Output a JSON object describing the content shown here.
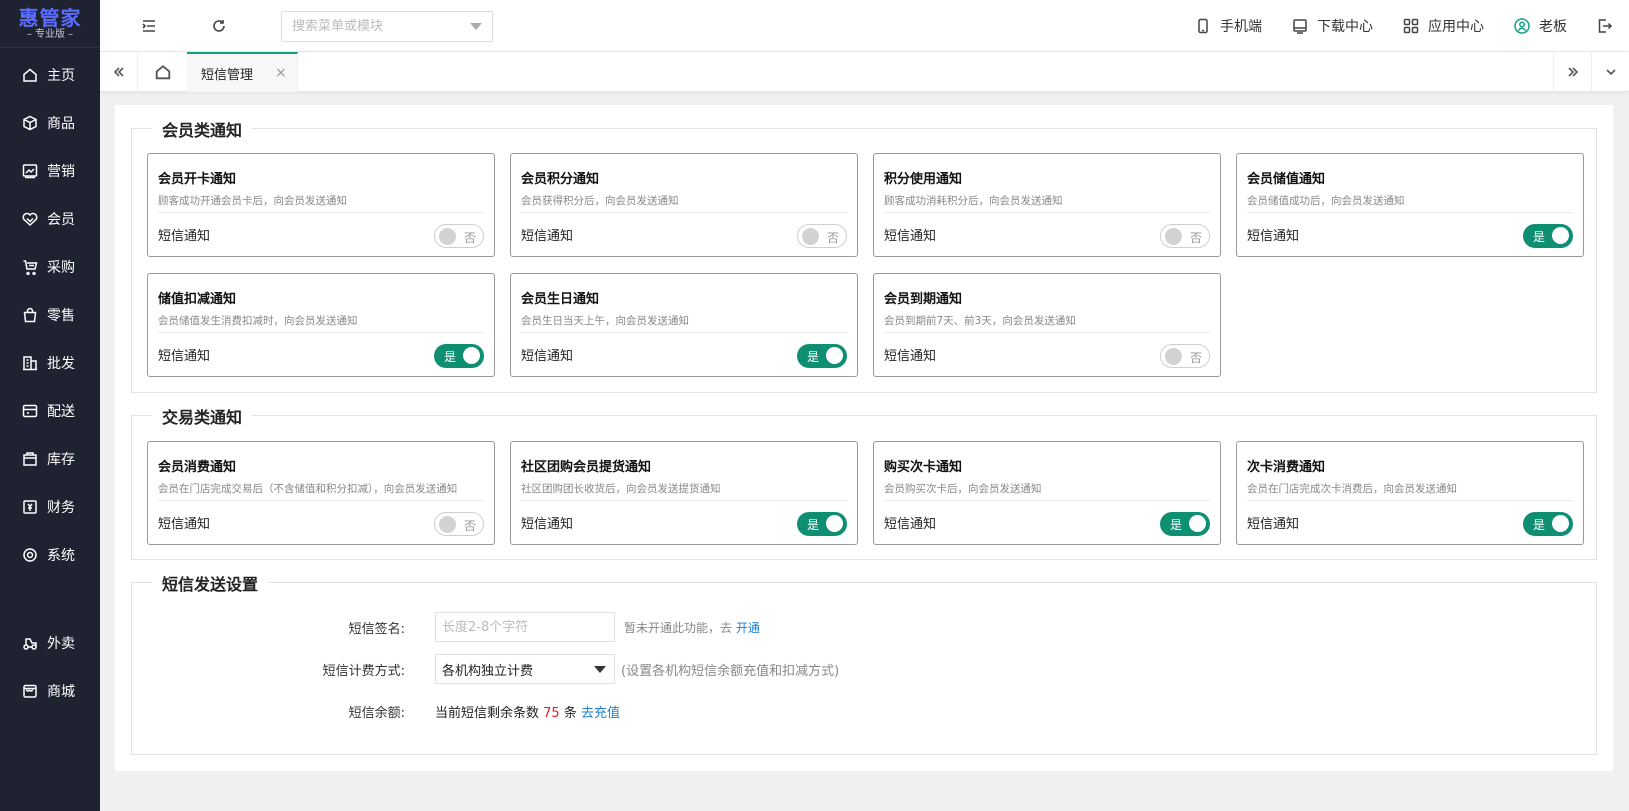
{
  "app": {
    "brand": "惠管家",
    "edition": "– 专业版 –"
  },
  "sidebar": {
    "items": [
      {
        "label": "主页",
        "icon": "home-icon"
      },
      {
        "label": "商品",
        "icon": "box-icon"
      },
      {
        "label": "营销",
        "icon": "chart-line-icon"
      },
      {
        "label": "会员",
        "icon": "heart-icon"
      },
      {
        "label": "采购",
        "icon": "purchase-icon"
      },
      {
        "label": "零售",
        "icon": "bag-icon"
      },
      {
        "label": "批发",
        "icon": "building-icon"
      },
      {
        "label": "配送",
        "icon": "delivery-icon"
      },
      {
        "label": "库存",
        "icon": "inventory-icon"
      },
      {
        "label": "财务",
        "icon": "finance-icon"
      },
      {
        "label": "系统",
        "icon": "settings-icon"
      }
    ],
    "extra_items": [
      {
        "label": "外卖",
        "icon": "takeout-icon"
      },
      {
        "label": "商城",
        "icon": "shop-icon"
      }
    ]
  },
  "topbar": {
    "search_placeholder": "搜索菜单或模块",
    "links": [
      {
        "label": "手机端",
        "icon": "mobile-icon"
      },
      {
        "label": "下载中心",
        "icon": "download-icon"
      },
      {
        "label": "应用中心",
        "icon": "apps-icon"
      },
      {
        "label": "老板",
        "icon": "user-icon"
      }
    ]
  },
  "tabs": {
    "active": "短信管理",
    "close": "×"
  },
  "sections": {
    "member": {
      "title": "会员类通知",
      "cards": [
        {
          "title": "会员开卡通知",
          "desc": "顾客成功开通会员卡后，向会员发送通知",
          "label": "短信通知",
          "enabled": false,
          "state": "否"
        },
        {
          "title": "会员积分通知",
          "desc": "会员获得积分后，向会员发送通知",
          "label": "短信通知",
          "enabled": false,
          "state": "否"
        },
        {
          "title": "积分使用通知",
          "desc": "顾客成功消耗积分后，向会员发送通知",
          "label": "短信通知",
          "enabled": false,
          "state": "否"
        },
        {
          "title": "会员储值通知",
          "desc": "会员储值成功后，向会员发送通知",
          "label": "短信通知",
          "enabled": true,
          "state": "是"
        },
        {
          "title": "储值扣减通知",
          "desc": "会员储值发生消费扣减时，向会员发送通知",
          "label": "短信通知",
          "enabled": true,
          "state": "是"
        },
        {
          "title": "会员生日通知",
          "desc": "会员生日当天上午，向会员发送通知",
          "label": "短信通知",
          "enabled": true,
          "state": "是"
        },
        {
          "title": "会员到期通知",
          "desc": "会员到期前7天、前3天，向会员发送通知",
          "label": "短信通知",
          "enabled": false,
          "state": "否"
        }
      ]
    },
    "trade": {
      "title": "交易类通知",
      "cards": [
        {
          "title": "会员消费通知",
          "desc": "会员在门店完成交易后（不含储值和积分扣减），向会员发送通知",
          "label": "短信通知",
          "enabled": false,
          "state": "否"
        },
        {
          "title": "社区团购会员提货通知",
          "desc": "社区团购团长收货后，向会员发送提货通知",
          "label": "短信通知",
          "enabled": true,
          "state": "是"
        },
        {
          "title": "购买次卡通知",
          "desc": "会员购买次卡后，向会员发送通知",
          "label": "短信通知",
          "enabled": true,
          "state": "是"
        },
        {
          "title": "次卡消费通知",
          "desc": "会员在门店完成次卡消费后，向会员发送通知",
          "label": "短信通知",
          "enabled": true,
          "state": "是"
        }
      ]
    },
    "settings": {
      "title": "短信发送设置",
      "signature_label": "短信签名:",
      "signature_placeholder": "长度2-8个字符",
      "signature_hint": "暂未开通此功能，去",
      "signature_link": "开通",
      "billing_label": "短信计费方式:",
      "billing_value": "各机构独立计费",
      "billing_note": "(设置各机构短信余额充值和扣减方式)",
      "balance_label": "短信余额:",
      "balance_prefix": "当前短信剩余条数",
      "balance_count": "75",
      "balance_unit": "条",
      "balance_link": "去充值"
    }
  },
  "colors": {
    "sidebar_bg": "#1f2230",
    "brand": "#5b6cff",
    "accent": "#0e8f72",
    "link": "#1e7fd6",
    "count_red": "#e02020"
  }
}
